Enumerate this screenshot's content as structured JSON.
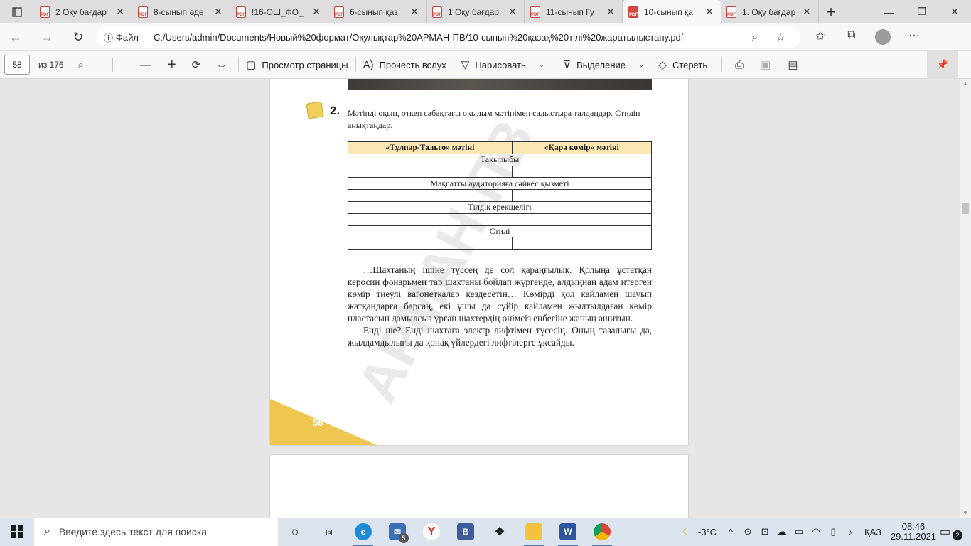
{
  "tabs": [
    {
      "label": "2 Оқу бағдар",
      "active": false
    },
    {
      "label": "8-сынып әде",
      "active": false
    },
    {
      "label": "!16-ОШ_ФО_",
      "active": false
    },
    {
      "label": "6-сынып қаз",
      "active": false
    },
    {
      "label": "1 Оқу бағдар",
      "active": false
    },
    {
      "label": "11-сынып Гу",
      "active": false
    },
    {
      "label": "10-сынып қа",
      "active": true
    },
    {
      "label": "1. Оқу бағдар",
      "active": false
    }
  ],
  "pdf_badge": "PDF",
  "address": {
    "scheme_label": "Файл",
    "url": "C:/Users/admin/Documents/Новый%20формат/Оқулықтар%20АРМАН-ПВ/10-сынып%20қазақ%20тілі%20жаратылыстану.pdf"
  },
  "pdf_toolbar": {
    "page_current": "58",
    "page_total": "из 176",
    "page_view_label": "Просмотр страницы",
    "read_aloud_label": "Прочесть вслух",
    "draw_label": "Нарисовать",
    "highlight_label": "Выделение",
    "erase_label": "Стереть"
  },
  "document": {
    "task_number": "2.",
    "task_text": "Мәтінді оқып, өткен сабақтағы оқылым мәтінімен салыстыра талдаңдар. Стилін анықтаңдар.",
    "table": {
      "headers": [
        "«Тұлпар-Тальго» мәтіні",
        "«Қара көмір» мәтіні"
      ],
      "section_titles": [
        "Тақырыбы",
        "Мақсатты аудиторияға сәйкес қызметі",
        "Тілдік ерекшелігі",
        "Стилі"
      ]
    },
    "paragraphs": [
      "…Шахтаның ішіне түссең де сол қараңғылық. Қолыңа ұстатқан керосин фонарьмен тар шахтаны бойлап жүргенде, алдыңнан адам итерген көмір тиеулі вагонеткалар кездесетін… Көмірді қол кайламен шауып жатқандарға барсаң, екі ұшы да сүйір кайламен жылтылдаған көмір пластасын дамылсыз ұрған шахтердің өнімсіз еңбегіне жаның ашитын.",
      "Енді ше? Енді шахтаға электр лифтімен түсесің. Оның тазалығы да, жылдамдылығы да қонақ үйлердегі лифтілерге ұқсайды."
    ],
    "page_number": "58",
    "watermark": "АРМАН-ПВ"
  },
  "taskbar": {
    "search_placeholder": "Введите здесь текст для поиска",
    "mail_badge": "5",
    "weather": "-3°C",
    "language": "ҚАЗ",
    "time": "08:46",
    "date": "29.11.2021",
    "notifications": "2"
  },
  "colors": {
    "accent_yellow": "#efc64f",
    "table_header": "#fbe7b4",
    "pdf_red": "#d9463f"
  }
}
